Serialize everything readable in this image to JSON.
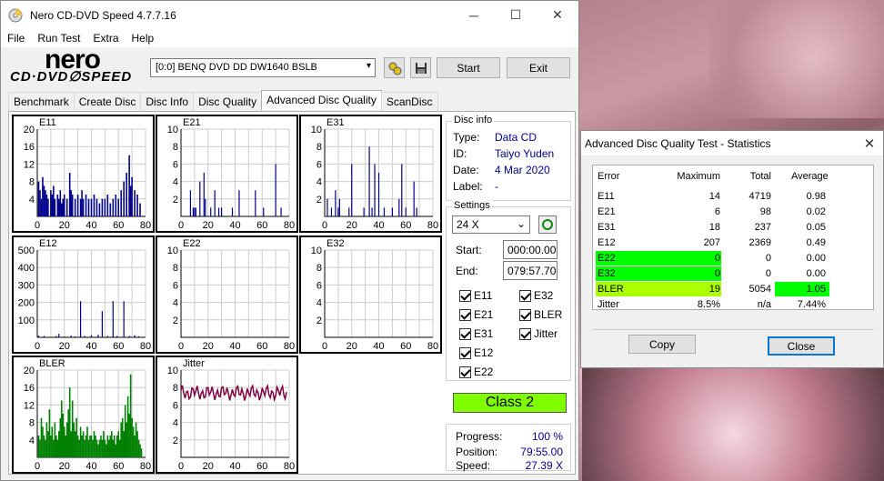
{
  "window": {
    "title": "Nero CD-DVD Speed 4.7.7.16",
    "minimize": "─",
    "maximize": "☐",
    "close": "✕"
  },
  "menu": [
    "File",
    "Run Test",
    "Extra",
    "Help"
  ],
  "logo": {
    "top": "nero",
    "bottom": "CD·DVD∅SPEED"
  },
  "drive": {
    "value": "[0:0]   BENQ DVD DD DW1640 BSLB",
    "arrow": "▾"
  },
  "buttons": {
    "start": "Start",
    "exit": "Exit",
    "copy": "Copy",
    "close": "Close"
  },
  "tabs": [
    "Benchmark",
    "Create Disc",
    "Disc Info",
    "Disc Quality",
    "Advanced Disc Quality",
    "ScanDisc"
  ],
  "disc_info": {
    "title": "Disc info",
    "type_label": "Type:",
    "type": "Data CD",
    "id_label": "ID:",
    "id": "Taiyo Yuden",
    "date_label": "Date:",
    "date": "4 Mar 2020",
    "label_label": "Label:",
    "label": "-"
  },
  "settings": {
    "title": "Settings",
    "speed": "24 X",
    "start_label": "Start:",
    "start": "000:00.00",
    "end_label": "End:",
    "end": "079:57.70",
    "checks": [
      "E11",
      "E32",
      "E21",
      "BLER",
      "E31",
      "Jitter",
      "E12",
      "E22"
    ]
  },
  "class": "Class 2",
  "progress": {
    "progress_label": "Progress:",
    "progress": "100 %",
    "position_label": "Position:",
    "position": "79:55.00",
    "speed_label": "Speed:",
    "speed": "27.39 X"
  },
  "colors": {
    "bars": "#00008b",
    "bler": "#008000",
    "jitter": "#800040",
    "class_bg": "#80ff00",
    "green": "#00ff00",
    "lime": "#aaff00"
  },
  "chart_data": [
    {
      "type": "bar",
      "title": "E11",
      "ylim": [
        0,
        20
      ],
      "yticks": [
        "20",
        "16",
        "12",
        "8",
        "4"
      ],
      "xticks": [
        "0",
        "20",
        "40",
        "60",
        "80"
      ],
      "xlim": [
        0,
        80
      ]
    },
    {
      "type": "bar",
      "title": "E21",
      "ylim": [
        0,
        10
      ],
      "yticks": [
        "10",
        "8",
        "6",
        "4",
        "2"
      ],
      "xticks": [
        "0",
        "20",
        "40",
        "60",
        "80"
      ],
      "xlim": [
        0,
        80
      ]
    },
    {
      "type": "bar",
      "title": "E31",
      "ylim": [
        0,
        10
      ],
      "yticks": [
        "10",
        "8",
        "6",
        "4",
        "2"
      ],
      "xticks": [
        "0",
        "20",
        "40",
        "60",
        "80"
      ],
      "xlim": [
        0,
        80
      ]
    },
    {
      "type": "bar",
      "title": "E12",
      "ylim": [
        0,
        500
      ],
      "yticks": [
        "500",
        "400",
        "300",
        "200",
        "100"
      ],
      "xticks": [
        "0",
        "20",
        "40",
        "60",
        "80"
      ],
      "xlim": [
        0,
        80
      ]
    },
    {
      "type": "bar",
      "title": "E22",
      "ylim": [
        0,
        10
      ],
      "yticks": [
        "10",
        "8",
        "6",
        "4",
        "2"
      ],
      "xticks": [
        "0",
        "20",
        "40",
        "60",
        "80"
      ],
      "xlim": [
        0,
        80
      ]
    },
    {
      "type": "bar",
      "title": "E32",
      "ylim": [
        0,
        10
      ],
      "yticks": [
        "10",
        "8",
        "6",
        "4",
        "2"
      ],
      "xticks": [
        "0",
        "20",
        "40",
        "60",
        "80"
      ],
      "xlim": [
        0,
        80
      ]
    },
    {
      "type": "bar",
      "title": "BLER",
      "ylim": [
        0,
        20
      ],
      "yticks": [
        "20",
        "16",
        "12",
        "8",
        "4"
      ],
      "xticks": [
        "0",
        "20",
        "40",
        "60",
        "80"
      ],
      "xlim": [
        0,
        80
      ]
    },
    {
      "type": "line",
      "title": "Jitter",
      "ylim": [
        0,
        10
      ],
      "yticks": [
        "10",
        "8",
        "6",
        "4",
        "2"
      ],
      "xticks": [
        "0",
        "20",
        "40",
        "60",
        "80"
      ],
      "xlim": [
        0,
        80
      ]
    }
  ],
  "stats": {
    "title": "Advanced Disc Quality Test - Statistics",
    "close": "✕",
    "headers": [
      "Error",
      "Maximum",
      "Total",
      "Average"
    ],
    "rows": [
      [
        "E11",
        "14",
        "4719",
        "0.98"
      ],
      [
        "E21",
        "6",
        "98",
        "0.02"
      ],
      [
        "E31",
        "18",
        "237",
        "0.05"
      ],
      [
        "E12",
        "207",
        "2369",
        "0.49"
      ],
      [
        "E22",
        "0",
        "0",
        "0.00"
      ],
      [
        "E32",
        "0",
        "0",
        "0.00"
      ],
      [
        "BLER",
        "19",
        "5054",
        "1.05"
      ],
      [
        "Jitter",
        "8.5%",
        "n/a",
        "7.44%"
      ]
    ]
  }
}
